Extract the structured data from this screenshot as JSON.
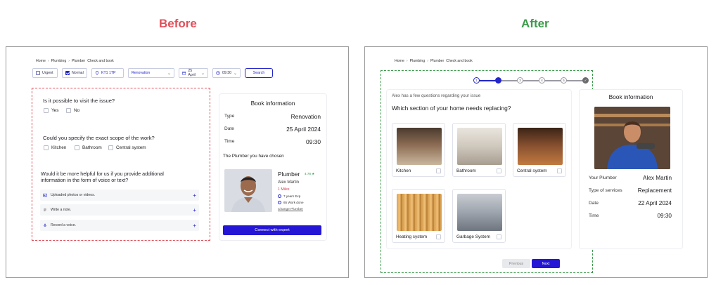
{
  "headings": {
    "before": "Before",
    "after": "After"
  },
  "colors": {
    "before": "#e0505a",
    "after": "#3a9b4a",
    "primary": "#2416d4"
  },
  "before": {
    "breadcrumb": [
      "Home",
      "Plumbing",
      "Plumber",
      "Check and book"
    ],
    "filters": {
      "urgent": "Urgent",
      "normal": "Normal",
      "location": "KT1 1TP",
      "service": "Renovation",
      "date": "25 April",
      "time": "09:30",
      "search": "Search"
    },
    "q1": {
      "title": "Is it possible to visit the issue?",
      "options": [
        "Yes",
        "No"
      ]
    },
    "q2": {
      "title": "Could you specify the exact scope of the work?",
      "options": [
        "Kitchen",
        "Bathroom",
        "Central system"
      ]
    },
    "q3": {
      "title_line1": "Would it be more helpful for us if you provide additional",
      "title_line2": "information in the form of voice or text?",
      "rows": [
        "Uploaded photos or videos.",
        "Write a note.",
        "Record a voice."
      ]
    },
    "book": {
      "title": "Book information",
      "type_label": "Type",
      "type_value": "Renovation",
      "date_label": "Date",
      "date_value": "25 April 2024",
      "time_label": "Time",
      "time_value": "09:30",
      "chosen": "The Plumber you have chosen",
      "plumber_title": "Plumber",
      "rating": "4.78 ★",
      "name": "Alex Martin",
      "miles": "1 Miles",
      "exp": "7 years Exp",
      "work": "65 Work done",
      "change": "Change Plumber",
      "connect": "Connect with expert"
    }
  },
  "after": {
    "breadcrumb": [
      "Home",
      "Plumbing",
      "Plumber",
      "Check and book"
    ],
    "steps": [
      "1",
      "2",
      "3",
      "4",
      "5",
      "✓"
    ],
    "question_sub": "Alex has a few questions regarding your issue",
    "question": "Which section of your home needs replacing?",
    "tiles": [
      "Kitchen",
      "Bathroom",
      "Central system",
      "Heating system",
      "Garbage System"
    ],
    "prev": "Previous",
    "next": "Next",
    "book": {
      "title": "Book information",
      "plumber_label": "Your Plumber",
      "plumber_value": "Alex Martin",
      "type_label": "Type of services",
      "type_value": "Replacement",
      "date_label": "Date",
      "date_value": "22 April 2024",
      "time_label": "Time",
      "time_value": "09:30"
    }
  }
}
